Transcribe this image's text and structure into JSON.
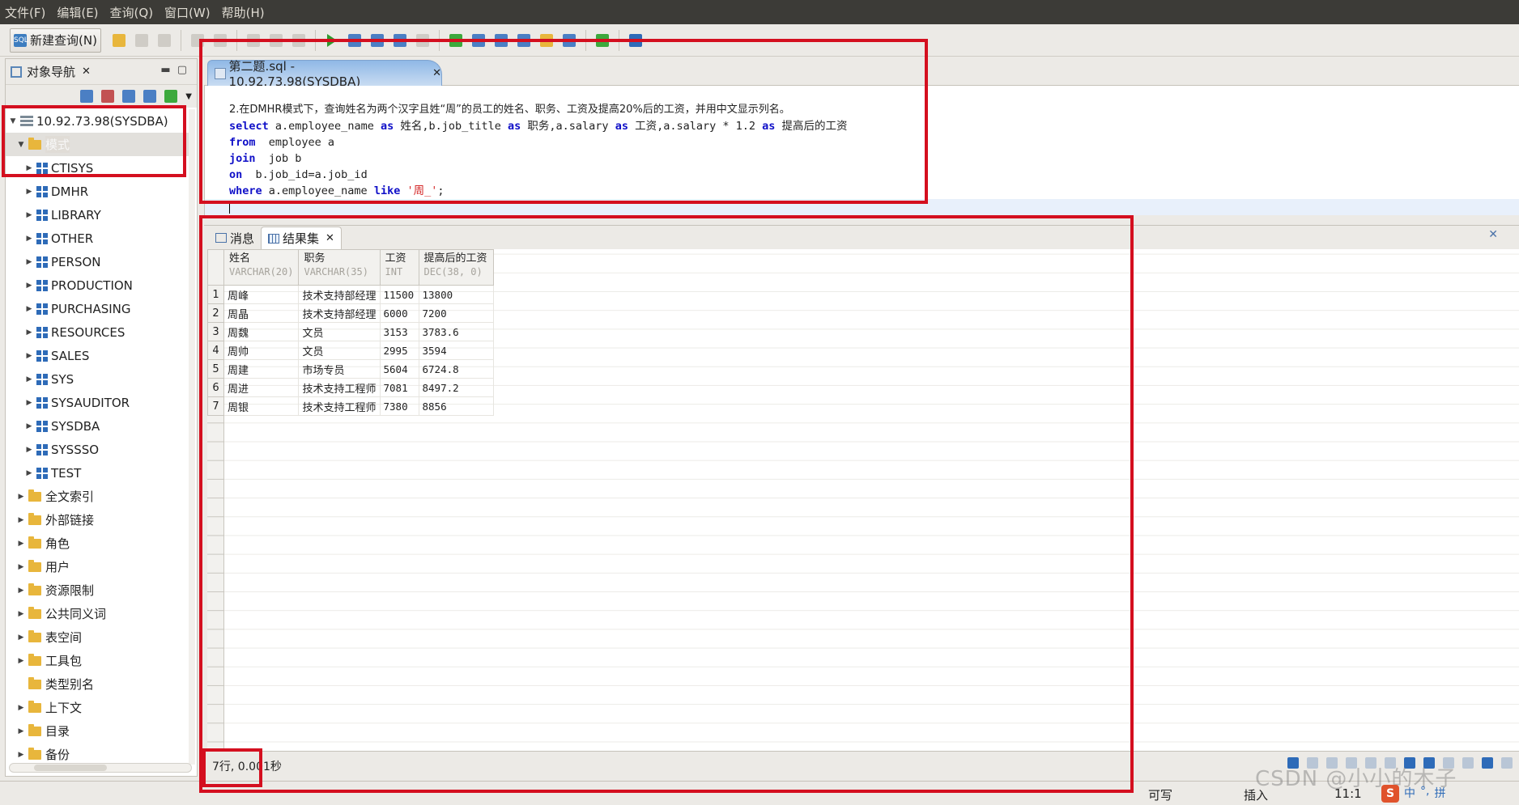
{
  "menubar": {
    "items": [
      "文件(F)",
      "编辑(E)",
      "查询(Q)",
      "窗口(W)",
      "帮助(H)"
    ]
  },
  "toolbar": {
    "new_query_label": "新建查询(N)"
  },
  "navigator": {
    "title": "对象导航",
    "connection": "10.92.73.98(SYSDBA)",
    "schema_folder": "模式",
    "schemas": [
      "CTISYS",
      "DMHR",
      "LIBRARY",
      "OTHER",
      "PERSON",
      "PRODUCTION",
      "PURCHASING",
      "RESOURCES",
      "SALES",
      "SYS",
      "SYSAUDITOR",
      "SYSDBA",
      "SYSSSO",
      "TEST"
    ],
    "folders": [
      "全文索引",
      "外部链接",
      "角色",
      "用户",
      "资源限制",
      "公共同义词",
      "表空间",
      "工具包",
      "类型别名",
      "上下文",
      "目录",
      "备份"
    ]
  },
  "editor": {
    "tab_title": "第二题.sql - 10.92.73.98(SYSDBA)",
    "lines": {
      "l1": "2.在DMHR模式下，查询姓名为两个汉字且姓“周”的员工的姓名、职务、工资及提高20%后的工资，并用中文显示列名。",
      "l2_kw1": "select",
      "l2_a": " a.employee_name ",
      "l2_kw2": "as",
      "l2_b": " 姓名,b.job_title ",
      "l2_kw3": "as",
      "l2_c": " 职务,a.salary ",
      "l2_kw4": "as",
      "l2_d": " 工资,a.salary * 1.2 ",
      "l2_kw5": "as",
      "l2_e": " 提高后的工资",
      "l3_kw": "from",
      "l3_rest": "  employee a",
      "l4_kw": "join",
      "l4_rest": "  job b",
      "l5_kw": "on",
      "l5_rest": "  b.job_id=a.job_id",
      "l6_kw1": "where",
      "l6_a": " a.employee_name ",
      "l6_kw2": "like",
      "l6_sp": " ",
      "l6_str": "'周_'",
      "l6_end": ";"
    }
  },
  "results": {
    "tabs": [
      "消息",
      "结果集"
    ],
    "columns": [
      {
        "name": "姓名",
        "type": "VARCHAR(20)"
      },
      {
        "name": "职务",
        "type": "VARCHAR(35)"
      },
      {
        "name": "工资",
        "type": "INT"
      },
      {
        "name": "提高后的工资",
        "type": "DEC(38, 0)"
      }
    ],
    "rows": [
      {
        "n": "1",
        "c1": "周峰",
        "c2": "技术支持部经理",
        "c3": "11500",
        "c4": "13800"
      },
      {
        "n": "2",
        "c1": "周晶",
        "c2": "技术支持部经理",
        "c3": "6000",
        "c4": "7200"
      },
      {
        "n": "3",
        "c1": "周魏",
        "c2": "文员",
        "c3": "3153",
        "c4": "3783.6"
      },
      {
        "n": "4",
        "c1": "周帅",
        "c2": "文员",
        "c3": "2995",
        "c4": "3594"
      },
      {
        "n": "5",
        "c1": "周建",
        "c2": "市场专员",
        "c3": "5604",
        "c4": "6724.8"
      },
      {
        "n": "6",
        "c1": "周进",
        "c2": "技术支持工程师",
        "c3": "7081",
        "c4": "8497.2"
      },
      {
        "n": "7",
        "c1": "周银",
        "c2": "技术支持工程师",
        "c3": "7380",
        "c4": "8856"
      }
    ],
    "status": "7行, 0.001秒"
  },
  "statusbar": {
    "writable": "可写",
    "insert": "插入",
    "position": "11:1"
  },
  "watermark": "CSDN @小小的木子",
  "ime": {
    "logo": "S",
    "lang": "中",
    "punct": "°,",
    "pinyin": "拼"
  },
  "colors": {
    "annotation_red": "#d40f1f",
    "keyword_blue": "#1010c8",
    "string_red": "#d42a2a"
  }
}
